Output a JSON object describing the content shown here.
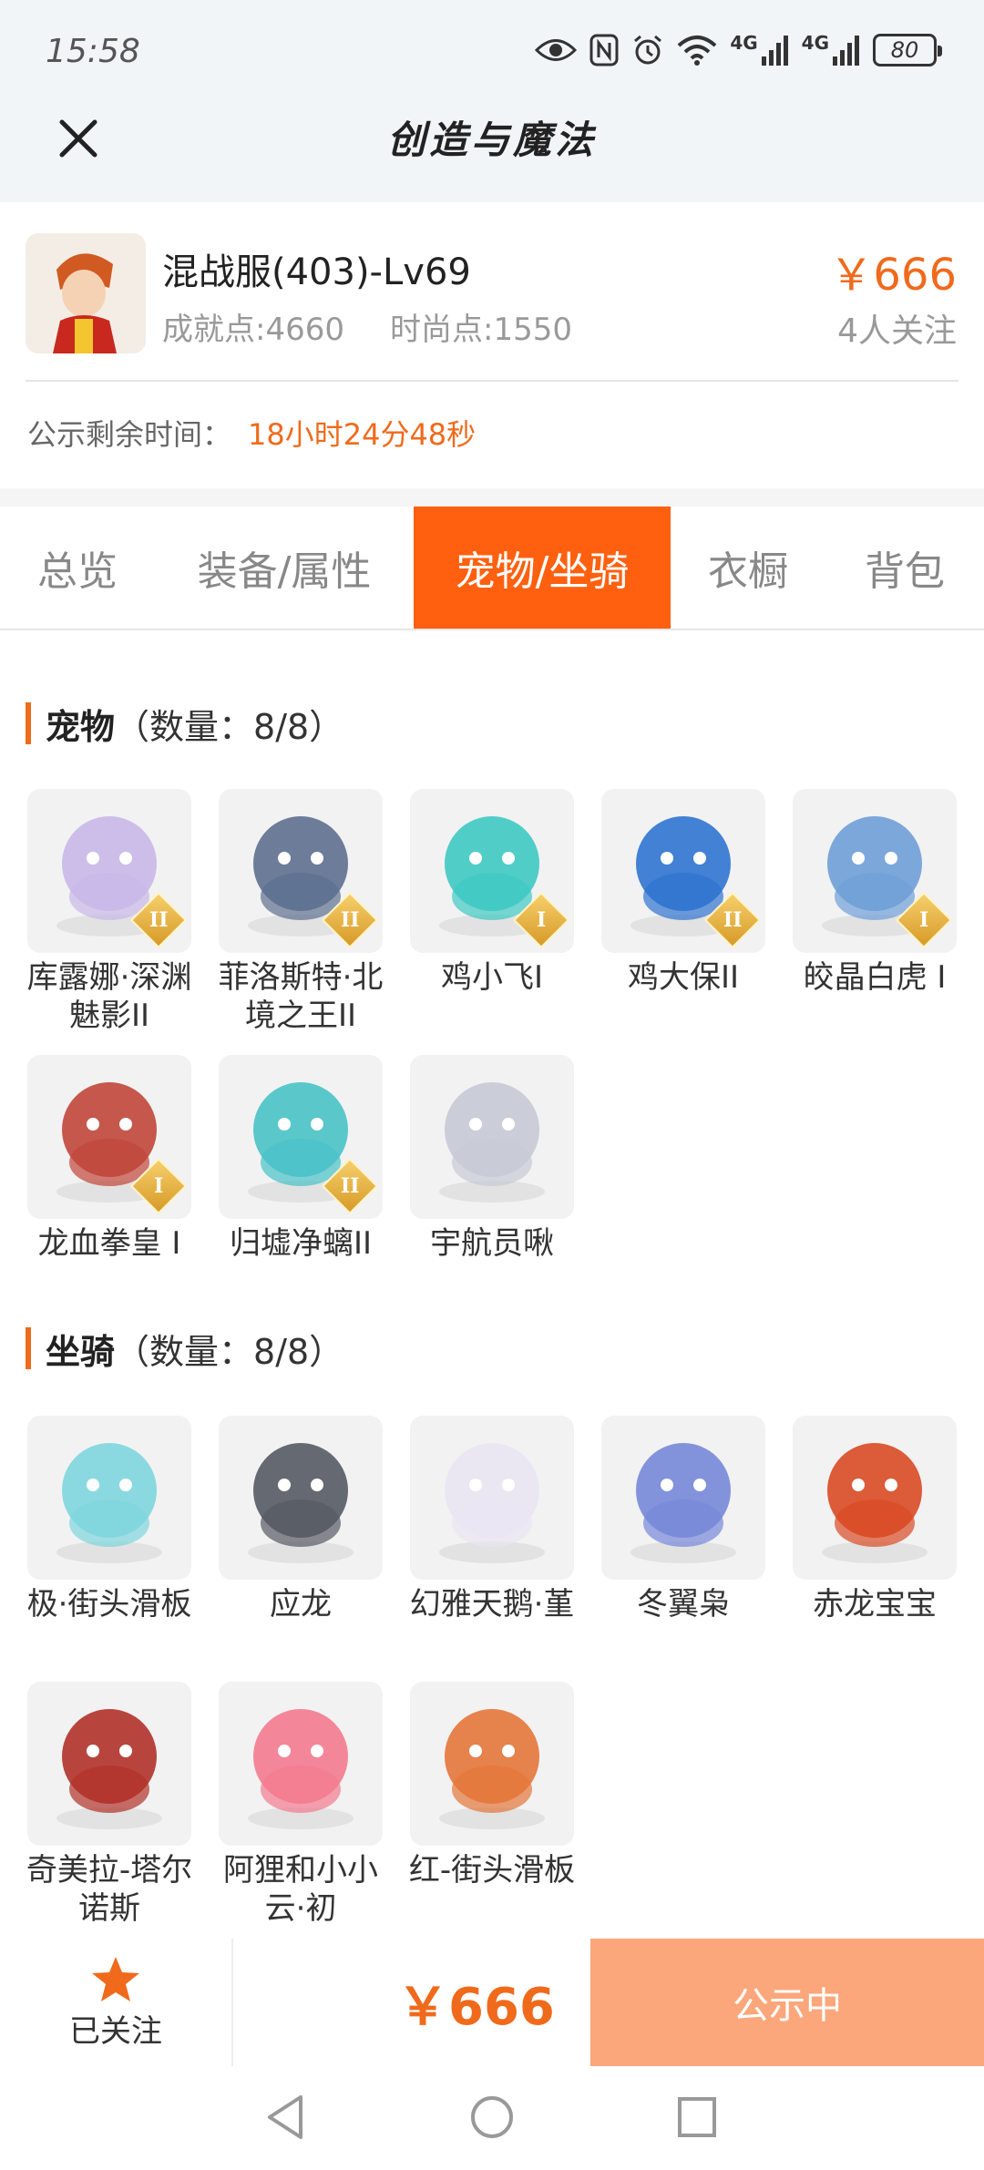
{
  "status_bar": {
    "time": "15:58",
    "network_1": "4G",
    "network_2": "4G",
    "battery": "80"
  },
  "header": {
    "title": "创造与魔法"
  },
  "item": {
    "name": "混战服(403)-Lv69",
    "price": "￥666",
    "achievement": "成就点:4660",
    "fashion": "时尚点:1550",
    "watchers": "4人关注",
    "remaining_label": "公示剩余时间：",
    "remaining_value": "18小时24分48秒"
  },
  "tabs": [
    {
      "label": "总览"
    },
    {
      "label": "装备/属性"
    },
    {
      "label": "宠物/坐骑"
    },
    {
      "label": "衣橱"
    },
    {
      "label": "背包"
    }
  ],
  "pets": {
    "title": "宠物",
    "count": "（数量：8/8）",
    "items": [
      {
        "name": "库露娜·深渊魅影II",
        "grade": "II",
        "color": "#c9b8e8"
      },
      {
        "name": "菲洛斯特·北境之王II",
        "grade": "II",
        "color": "#5d6f8f"
      },
      {
        "name": "鸡小飞I",
        "grade": "I",
        "color": "#3fc9c3"
      },
      {
        "name": "鸡大保II",
        "grade": "II",
        "color": "#2f74d0"
      },
      {
        "name": "皎晶白虎 I",
        "grade": "I",
        "color": "#6f9fd8"
      },
      {
        "name": "龙血拳皇 I",
        "grade": "I",
        "color": "#c0463a"
      },
      {
        "name": "归墟净螭II",
        "grade": "II",
        "color": "#49c2c7"
      },
      {
        "name": "宇航员啾",
        "grade": "",
        "color": "#c7cad6"
      }
    ]
  },
  "mounts": {
    "title": "坐骑",
    "count": "（数量：8/8）",
    "items": [
      {
        "name": "极·街头滑板",
        "color": "#7fd6de"
      },
      {
        "name": "应龙",
        "color": "#555a63"
      },
      {
        "name": "幻雅天鹅·堇",
        "color": "#e9e6f3"
      },
      {
        "name": "冬翼枭",
        "color": "#7688d9"
      },
      {
        "name": "赤龙宝宝",
        "color": "#d94a23"
      },
      {
        "name": "奇美拉-塔尔诺斯",
        "color": "#b0322a"
      },
      {
        "name": "阿狸和小小云·初",
        "color": "#f47a8f"
      },
      {
        "name": "红-街头滑板",
        "color": "#e4763a"
      }
    ]
  },
  "bottom": {
    "follow_label": "已关注",
    "price": "￥666",
    "button": "公示中"
  }
}
